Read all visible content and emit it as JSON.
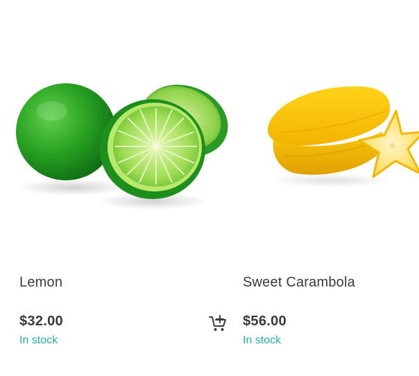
{
  "products": [
    {
      "name": "Lemon",
      "price": "$32.00",
      "stock_status": "In stock",
      "image_icon": "lime-image",
      "cart_icon": "add-to-cart-icon"
    },
    {
      "name": "Sweet Carambola",
      "price": "$56.00",
      "stock_status": "In stock",
      "image_icon": "carambola-image"
    }
  ],
  "colors": {
    "stock": "#22b3a0",
    "text": "#3a3a3a",
    "background": "#ffffff"
  }
}
